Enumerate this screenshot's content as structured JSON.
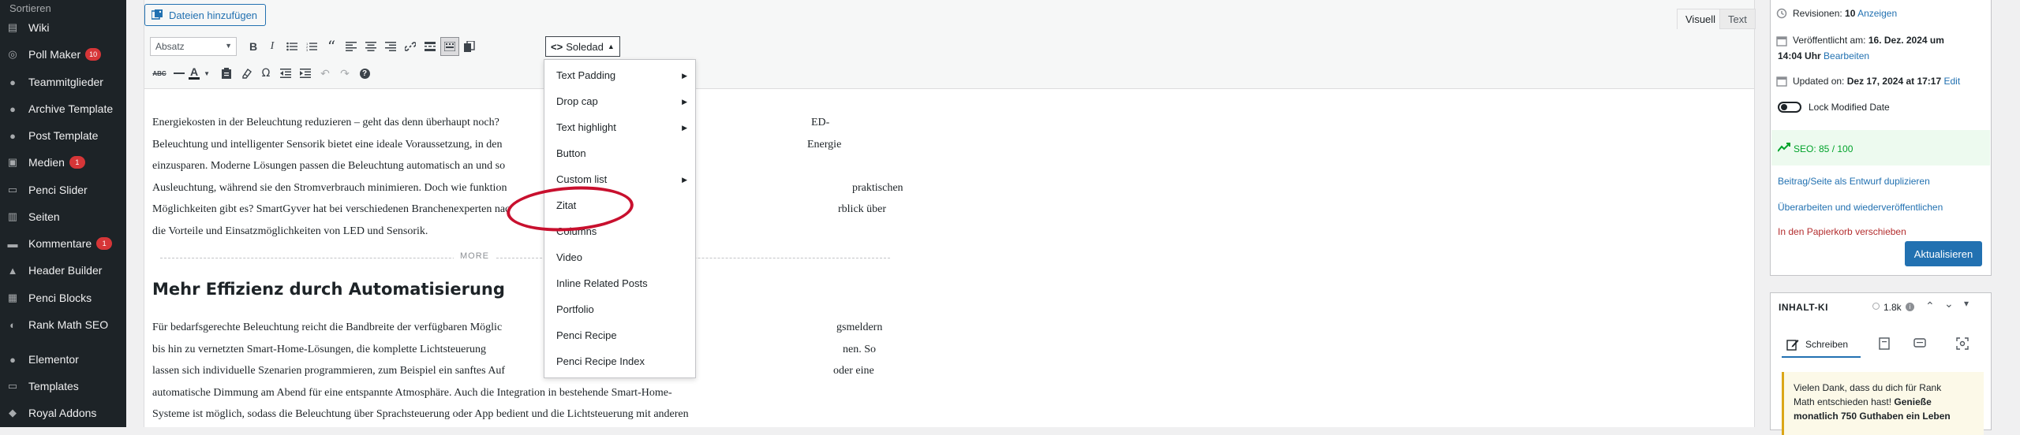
{
  "sidebar": {
    "top_label": "Sortieren",
    "items": [
      {
        "label": "Wiki",
        "icon": "wiki-icon",
        "badge": ""
      },
      {
        "label": "Poll Maker",
        "icon": "poll-icon",
        "badge": "10"
      },
      {
        "label": "Teammitglieder",
        "icon": "team-icon",
        "badge": ""
      },
      {
        "label": "Archive Template",
        "icon": "archive-icon",
        "badge": ""
      },
      {
        "label": "Post Template",
        "icon": "template-icon",
        "badge": ""
      },
      {
        "label": "Medien",
        "icon": "media-icon",
        "badge": "1"
      },
      {
        "label": "Penci Slider",
        "icon": "slider-icon",
        "badge": ""
      },
      {
        "label": "Seiten",
        "icon": "pages-icon",
        "badge": ""
      },
      {
        "label": "Kommentare",
        "icon": "comments-icon",
        "badge": "1"
      },
      {
        "label": "Header Builder",
        "icon": "header-icon",
        "badge": ""
      },
      {
        "label": "Penci Blocks",
        "icon": "blocks-icon",
        "badge": ""
      },
      {
        "label": "Rank Math SEO",
        "icon": "rankmath-icon",
        "badge": ""
      },
      {
        "label": "Elementor",
        "icon": "elementor-icon",
        "badge": ""
      },
      {
        "label": "Templates",
        "icon": "templates-icon",
        "badge": ""
      },
      {
        "label": "Royal Addons",
        "icon": "addons-icon",
        "badge": ""
      }
    ]
  },
  "editor": {
    "add_media_label": "Dateien hinzufügen",
    "tabs": {
      "visual": "Visuell",
      "text": "Text"
    },
    "format_select": "Absatz",
    "soledad_label": "Soledad",
    "content_lines": [
      "Energiekosten in der Beleuchtung reduzieren – geht das denn überhaupt noch?",
      "Beleuchtung und intelligenter Sensorik bietet eine ideale Voraussetzung, in den",
      "einzusparen. Moderne Lösungen passen die Beleuchtung automatisch an und so",
      "Ausleuchtung, während sie den Stromverbrauch minimieren. Doch wie funktion",
      "Möglichkeiten gibt es? SmartGyver hat bei verschiedenen Branchenexperten nac",
      "die Vorteile und Einsatzmöglichkeiten von LED und Sensorik."
    ],
    "content_right_fragments": [
      {
        "text": "ED-",
        "line": 0
      },
      {
        "text": "Energie",
        "line": 1
      },
      {
        "text": "praktischen",
        "line": 3
      },
      {
        "text": "rblick über",
        "line": 4
      }
    ],
    "more_label": "MORE",
    "heading": "Mehr Effizienz durch Automatisierung",
    "content_lines_2": [
      "Für bedarfsgerechte Beleuchtung reicht die Bandbreite der verfügbaren Möglic",
      "bis hin zu vernetzten Smart-Home-Lösungen, die komplette Lichtsteuerung",
      "lassen sich individuelle Szenarien programmieren, zum Beispiel ein sanftes Auf",
      "automatische Dimmung am Abend für eine entspannte Atmosphäre. Auch die Integration in bestehende Smart-Home-",
      "Systeme ist möglich, sodass die Beleuchtung über Sprachsteuerung oder App bedient und die Lichtsteuerung mit anderen"
    ],
    "content_right_fragments_2": [
      {
        "text": "gsmeldern",
        "line": 0
      },
      {
        "text": "nen. So",
        "line": 1
      },
      {
        "text": "oder eine",
        "line": 2
      }
    ]
  },
  "dropdown": {
    "items": [
      {
        "label": "Text Padding",
        "submenu": true
      },
      {
        "label": "Drop cap",
        "submenu": true
      },
      {
        "label": "Text highlight",
        "submenu": true
      },
      {
        "label": "Button",
        "submenu": false
      },
      {
        "label": "Custom list",
        "submenu": true
      },
      {
        "label": "Zitat",
        "submenu": false
      },
      {
        "label": "Columns",
        "submenu": false
      },
      {
        "label": "Video",
        "submenu": false
      },
      {
        "label": "Inline Related Posts",
        "submenu": false
      },
      {
        "label": "Portfolio",
        "submenu": false
      },
      {
        "label": "Penci Recipe",
        "submenu": false
      },
      {
        "label": "Penci Recipe Index",
        "submenu": false
      }
    ]
  },
  "publish": {
    "revisions_label": "Revisionen:",
    "revisions_count": "10",
    "revisions_link": "Anzeigen",
    "published_label": "Veröffentlicht am:",
    "published_date": "16. Dez. 2024 um",
    "published_time": "14:04 Uhr",
    "published_edit": "Bearbeiten",
    "updated_label": "Updated on:",
    "updated_value": "Dez 17, 2024 at 17:17",
    "updated_edit": "Edit",
    "lock_label": "Lock Modified Date",
    "seo_label": "SEO: 85 / 100",
    "duplicate_link": "Beitrag/Seite als Entwurf duplizieren",
    "republish_link": "Überarbeiten und wiederveröffentlichen",
    "trash_link": "In den Papierkorb verschieben",
    "update_button": "Aktualisieren"
  },
  "ai_panel": {
    "title": "INHALT-KI",
    "credits": "1.8k",
    "tab_write": "Schreiben",
    "notice_line1": "Vielen Dank, dass du dich für Rank",
    "notice_line2a": "Math entschieden hast!",
    "notice_line2b": "Genieße",
    "notice_line3": "monatlich 750 Guthaben ein Leben"
  },
  "colors": {
    "accent": "#2271b1",
    "sidebar_bg": "#1d2327",
    "badge": "#d63638",
    "annotation": "#c8102e",
    "seo_green": "#00a32a",
    "trash": "#b32d2e"
  }
}
